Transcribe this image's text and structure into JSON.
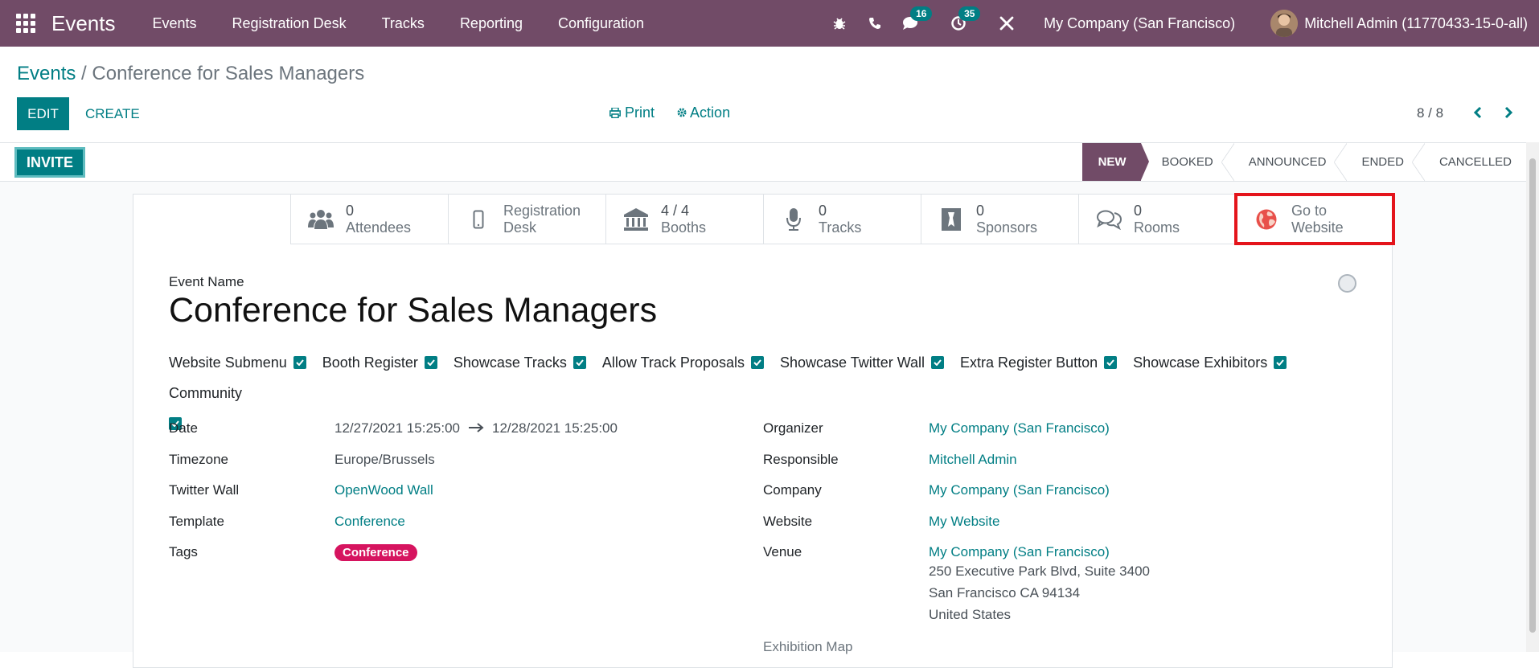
{
  "navbar": {
    "brand": "Events",
    "menu": [
      "Events",
      "Registration Desk",
      "Tracks",
      "Reporting",
      "Configuration"
    ],
    "messages_count": "16",
    "activities_count": "35",
    "company": "My Company (San Francisco)",
    "user": "Mitchell Admin (11770433-15-0-all)",
    "icons": [
      "apps-icon",
      "bug-icon",
      "phone-icon",
      "chat-icon",
      "clock-icon",
      "tools-icon"
    ]
  },
  "breadcrumb": {
    "parent": "Events",
    "separator": " / ",
    "current": "Conference for Sales Managers"
  },
  "control": {
    "edit": "EDIT",
    "create": "CREATE",
    "print": "Print",
    "action": "Action",
    "pager": "8 / 8"
  },
  "statusbar": {
    "invite": "INVITE",
    "stages": [
      "NEW",
      "BOOKED",
      "ANNOUNCED",
      "ENDED",
      "CANCELLED"
    ],
    "active_stage": "NEW"
  },
  "smart_buttons": [
    {
      "value": "0",
      "label": "Attendees",
      "icon": "users-icon"
    },
    {
      "value": "Registration",
      "label": "Desk",
      "icon": "mobile-icon"
    },
    {
      "value": "4 / 4",
      "label": "Booths",
      "icon": "bank-icon"
    },
    {
      "value": "0",
      "label": "Tracks",
      "icon": "microphone-icon"
    },
    {
      "value": "0",
      "label": "Sponsors",
      "icon": "sponsor-icon"
    },
    {
      "value": "0",
      "label": "Rooms",
      "icon": "comments-icon"
    },
    {
      "value": "Go to",
      "label": "Website",
      "icon": "globe-icon"
    }
  ],
  "form": {
    "event_name_label": "Event Name",
    "event_name": "Conference for Sales Managers",
    "checkboxes": [
      "Website Submenu",
      "Booth Register",
      "Showcase Tracks",
      "Allow Track Proposals",
      "Showcase Twitter Wall",
      "Extra Register Button",
      "Showcase Exhibitors",
      "Community"
    ],
    "left": {
      "date_label": "Date",
      "date_start": "12/27/2021 15:25:00",
      "date_end": "12/28/2021 15:25:00",
      "timezone_label": "Timezone",
      "timezone": "Europe/Brussels",
      "twitter_label": "Twitter Wall",
      "twitter": "OpenWood Wall",
      "template_label": "Template",
      "template": "Conference",
      "tags_label": "Tags",
      "tag": "Conference"
    },
    "right": {
      "organizer_label": "Organizer",
      "organizer": "My Company (San Francisco)",
      "responsible_label": "Responsible",
      "responsible": "Mitchell Admin",
      "company_label": "Company",
      "company": "My Company (San Francisco)",
      "website_label": "Website",
      "website": "My Website",
      "venue_label": "Venue",
      "venue": "My Company (San Francisco)",
      "venue_line1": "250 Executive Park Blvd, Suite 3400",
      "venue_line2": "San Francisco CA 94134",
      "venue_line3": "United States",
      "exhibition_label": "Exhibition Map"
    }
  },
  "colors": {
    "brand": "#714B67",
    "accent": "#017e84",
    "tag": "#d6145f",
    "highlight": "#e4141b"
  }
}
